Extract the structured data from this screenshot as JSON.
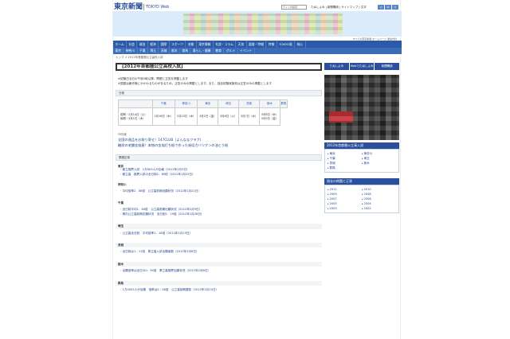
{
  "header": {
    "logo": "東京新聞",
    "logo_sub": "TOKYO Web",
    "search_placeholder": "サイト内検索",
    "links": "たぬしよみ | 新聞購読 | サイトマップ | 文字",
    "font_buttons": [
      "小",
      "中",
      "大"
    ]
  },
  "nav": {
    "row1": [
      "ホーム",
      "社会",
      "政治",
      "経済",
      "国際",
      "スポーツ",
      "芸能",
      "東京情報",
      "社説・コラム",
      "天気",
      "図書・特報",
      "特報",
      "TOKYO発",
      "核心"
    ],
    "row2": [
      "東京",
      "神奈川",
      "千葉",
      "埼玉",
      "茨城",
      "栃木",
      "群馬",
      "暮らし・健康",
      "教育",
      "グルメ",
      "イベント"
    ],
    "right_note": "すべての東京新聞 ホームページ 運営方針"
  },
  "breadcrumb": "トップ > 2012年首都圏公立高校入試",
  "page_title": "【2012年首都圏公立高校入試】",
  "intro": [
    "※試験日当日の午後5時以降、問題と正答を掲載します",
    "※国語は著作権にかかわるものがあるため、正答のみの掲載とします。また、独自試験実施校は正答のみの掲載とします"
  ],
  "schedule": {
    "heading": "日程",
    "prefectures": [
      "千葉",
      "神奈川",
      "東京",
      "埼玉",
      "茨城",
      "栃木",
      "群馬"
    ],
    "row_label": [
      "前期・2月14日（火）",
      "後期・3月1日（木）"
    ],
    "dates": [
      "2月16日（木）",
      "2月23日（木）",
      "3月2日（金）",
      "3月6日（火）",
      "3月7日（水）"
    ],
    "last_dates": [
      "3月8日（木）",
      "3月9日（金）"
    ]
  },
  "pr": {
    "label": "PR情報",
    "links": [
      "全国の逸品をお取り寄せ！147CLUB（よんななクラブ）",
      "糖尿の老舗金箔屋！本物の金箔打ち紙で作った吸収力バツグンの油とり紙"
    ]
  },
  "related": {
    "heading": "関連記事",
    "regions": [
      {
        "name": "東京",
        "items": [
          "都立推薦入試　1万809人が合格（2012年2月3日）",
          "都立高　推薦入試の全日制2．89倍（2012年1月25日）"
        ]
      },
      {
        "name": "神奈川",
        "items": [
          "平均倍率2．08倍　公立高前期出願状況（2012年1月21日）"
        ]
      },
      {
        "name": "千葉",
        "items": [
          "全日制平均1．84倍　公立高前期出願状況（2012年2月9日）",
          "県内公立高前期志願状況　全日制1．19倍（2012年1月28日）"
        ]
      },
      {
        "name": "埼玉",
        "items": [
          "公立高全日制　平均倍率1．18倍（2012年1月13日）"
        ]
      },
      {
        "name": "茨城",
        "items": [
          "全日制は1．11倍　県立高入試出願者数（2012年2月8日）"
        ]
      },
      {
        "name": "栃木",
        "items": [
          "出願倍率は全日の0．94倍　県立高推薦出願状況（2012年2月8日）"
        ]
      },
      {
        "name": "群馬",
        "items": [
          "1万4002人が出願　倍率は2・28倍　公立高前期選抜（2012年2月10日）"
        ]
      }
    ]
  },
  "sidebar": {
    "buttons": [
      "たぬしよみ",
      "Webでたぬしよみ",
      "新聞購読"
    ],
    "box_title": "2012年首都圏公立高入試",
    "box_items": [
      "東京",
      "神奈川",
      "千葉",
      "埼玉",
      "茨城",
      "栃木",
      "群馬"
    ],
    "archive_title": "過去の問題と正答",
    "years": [
      "2011",
      "2010",
      "2009",
      "2008",
      "2007",
      "2006",
      "2005",
      "2004",
      "2003",
      "2002"
    ]
  }
}
